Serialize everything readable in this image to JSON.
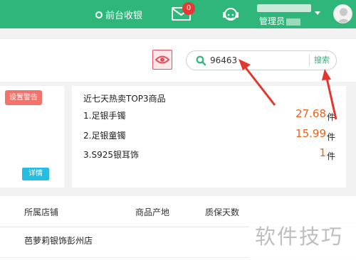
{
  "topbar": {
    "pos_label": "前台收银",
    "mail_badge": "0",
    "user_role": "管理员",
    "brand_color": "#2fb67a"
  },
  "toolbar": {
    "eye_icon": "eye-icon"
  },
  "search": {
    "value": "96463",
    "button_label": "搜索"
  },
  "left_card": {
    "warn_label": "设置警告",
    "detail_label": "详情"
  },
  "top_sales": {
    "title": "近七天热卖TOP3商品",
    "items": [
      {
        "name": "1.足银手镯",
        "value": "27.68",
        "unit": "件"
      },
      {
        "name": "2.足银童镯",
        "value": "15.99",
        "unit": "件"
      },
      {
        "name": "3.S925银耳饰",
        "value": "1",
        "unit": "件"
      }
    ]
  },
  "table": {
    "headers": [
      "所属店铺",
      "商品产地",
      "质保天数"
    ],
    "rows": [
      {
        "store": "芭萝莉银饰彭州店"
      }
    ]
  },
  "watermark": "软件技巧"
}
